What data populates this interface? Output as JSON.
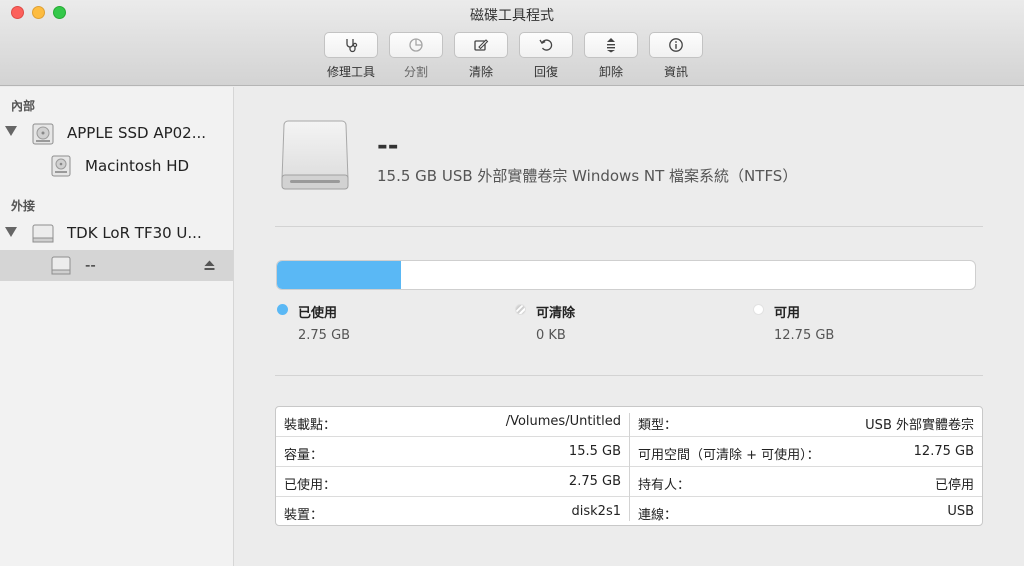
{
  "window": {
    "title": "磁碟工具程式"
  },
  "toolbar": {
    "items": [
      {
        "label": "修理工具",
        "icon": "stethoscope-icon",
        "enabled": true
      },
      {
        "label": "分割",
        "icon": "pie-chart-icon",
        "enabled": false
      },
      {
        "label": "清除",
        "icon": "erase-icon",
        "enabled": true
      },
      {
        "label": "回復",
        "icon": "restore-icon",
        "enabled": true
      },
      {
        "label": "卸除",
        "icon": "unmount-icon",
        "enabled": true
      },
      {
        "label": "資訊",
        "icon": "info-icon",
        "enabled": true
      }
    ]
  },
  "sidebar": {
    "internal_header": "內部",
    "external_header": "外接",
    "items": [
      {
        "label": "APPLE SSD AP02...",
        "icon": "internal-disk-icon"
      },
      {
        "label": "Macintosh HD",
        "icon": "volume-icon"
      },
      {
        "label": "TDK LoR TF30 U...",
        "icon": "external-disk-icon"
      },
      {
        "label": "--",
        "icon": "volume-icon",
        "selected": true
      }
    ]
  },
  "volume": {
    "name": "--",
    "description": "15.5 GB USB 外部實體卷宗 Windows NT 檔案系統（NTFS）"
  },
  "usage": {
    "used_fraction": 0.177,
    "legend": [
      {
        "label": "已使用",
        "value": "2.75 GB",
        "color": "#5ab8f5"
      },
      {
        "label": "可清除",
        "value": "0 KB",
        "color": "#dcdcdc"
      },
      {
        "label": "可用",
        "value": "12.75 GB",
        "color": "#ffffff"
      }
    ]
  },
  "info": {
    "left": [
      {
        "key": "裝載點：",
        "value": "/Volumes/Untitled"
      },
      {
        "key": "容量：",
        "value": "15.5 GB"
      },
      {
        "key": "已使用：",
        "value": "2.75 GB"
      },
      {
        "key": "裝置：",
        "value": "disk2s1"
      }
    ],
    "right": [
      {
        "key": "類型：",
        "value": "USB 外部實體卷宗"
      },
      {
        "key": "可用空間（可清除 + 可使用）：",
        "value": "12.75 GB"
      },
      {
        "key": "持有人：",
        "value": "已停用"
      },
      {
        "key": "連線：",
        "value": "USB"
      }
    ]
  }
}
